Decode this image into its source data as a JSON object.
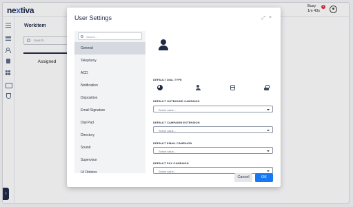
{
  "app": {
    "logo_text_a": "ne",
    "logo_text_b": "x",
    "logo_text_c": "tiva",
    "status_label": "Busy",
    "status_timer": "1m 43s",
    "status_badge": "×"
  },
  "workitem": {
    "title": "Workitem",
    "search_placeholder": "Search...",
    "tab_assigned": "Assigned"
  },
  "expand_handle": "›",
  "modal": {
    "title": "User Settings",
    "expand_glyph": "⤢",
    "close_glyph": "×",
    "search_placeholder": "Search...",
    "categories": [
      {
        "label": "General",
        "active": true
      },
      {
        "label": "Telephony",
        "active": false
      },
      {
        "label": "ACD",
        "active": false
      },
      {
        "label": "Notification",
        "active": false
      },
      {
        "label": "Disposition",
        "active": false
      },
      {
        "label": "Email Signature",
        "active": false
      },
      {
        "label": "Dial Pad",
        "active": false
      },
      {
        "label": "Directory",
        "active": false
      },
      {
        "label": "Sound",
        "active": false
      },
      {
        "label": "Supervisor",
        "active": false
      },
      {
        "label": "UI Options",
        "active": false
      }
    ],
    "default_dial_type_label": "DEFAULT DIAL TYPE",
    "fields": [
      {
        "label": "DEFAULT OUTBOUND CAMPAIGN",
        "value": "Select value..."
      },
      {
        "label": "DEFAULT CAMPAIGN EXTENSION",
        "value": "Select value..."
      },
      {
        "label": "DEFAULT EMAIL CAMPAIGN",
        "value": "Select value..."
      },
      {
        "label": "DEFAULT FAX CAMPAIGN",
        "value": "Select value..."
      }
    ],
    "cancel_label": "Cancel",
    "ok_label": "OK"
  },
  "colors": {
    "brand": "#1f2a44",
    "accent": "#2f6fe4",
    "primary_button": "#1778f2",
    "busy_badge": "#e0293b"
  }
}
